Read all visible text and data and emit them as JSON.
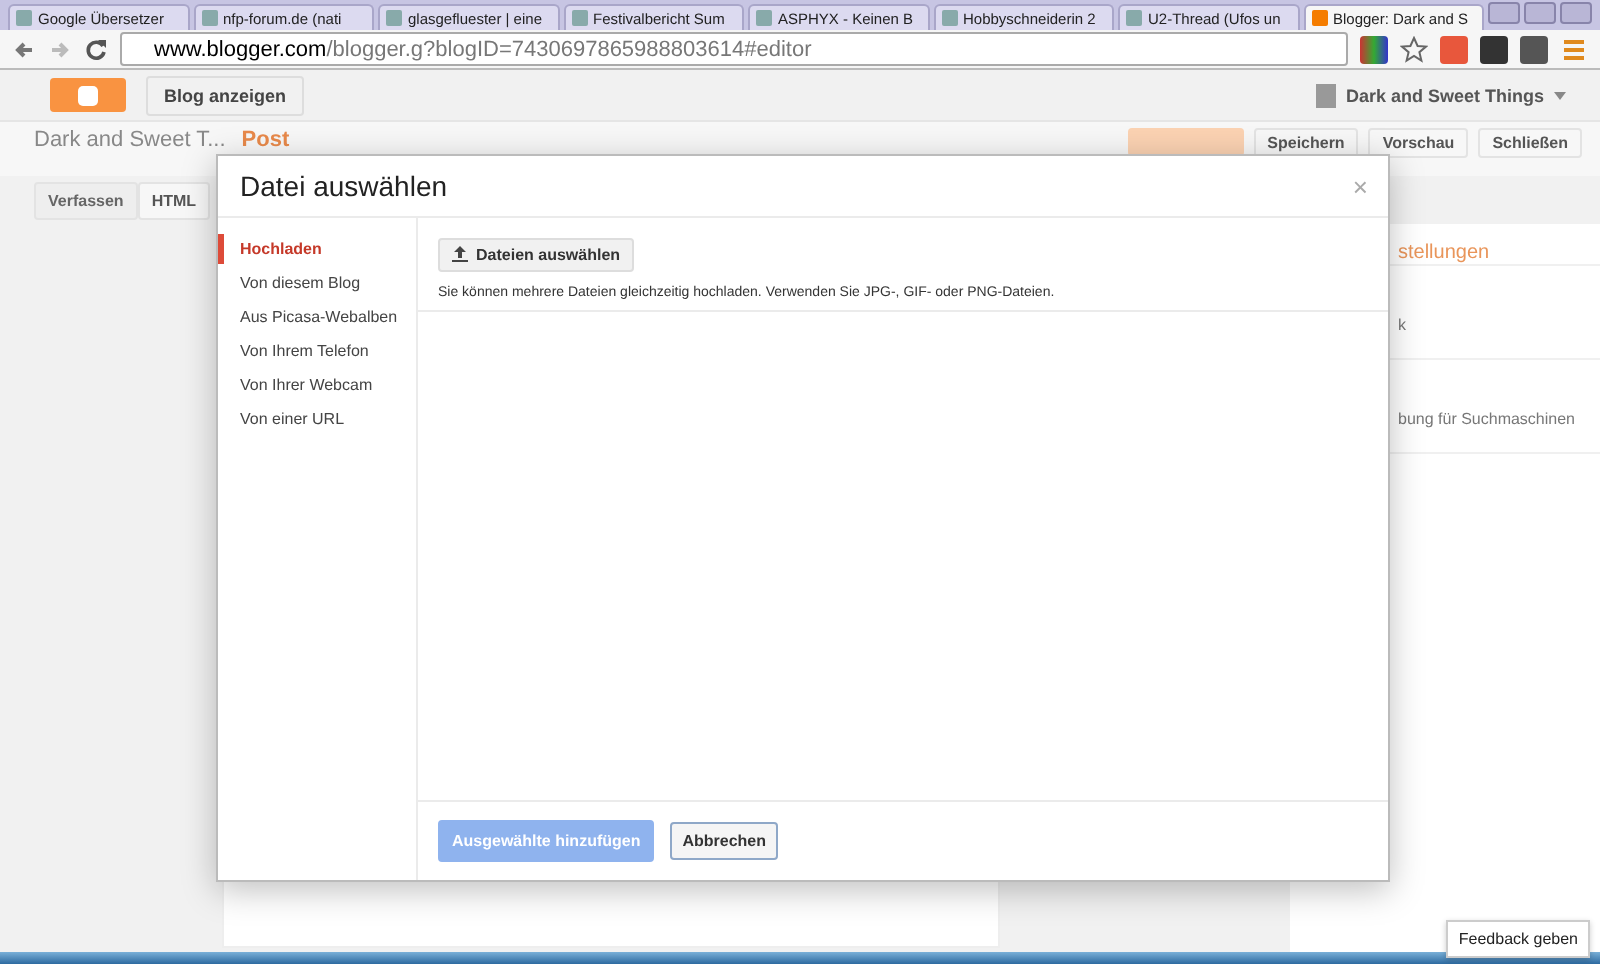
{
  "browser": {
    "tabs": [
      {
        "title": "Google Übersetzer",
        "selected": false
      },
      {
        "title": "nfp-forum.de (nati",
        "selected": false
      },
      {
        "title": "glasgefluester | eine",
        "selected": false
      },
      {
        "title": "Festivalbericht Sum",
        "selected": false
      },
      {
        "title": "ASPHYX - Keinen B",
        "selected": false
      },
      {
        "title": "Hobbyschneiderin 2",
        "selected": false
      },
      {
        "title": "U2-Thread (Ufos un",
        "selected": false
      },
      {
        "title": "Blogger: Dark and S",
        "selected": true
      }
    ],
    "url_host": "www.blogger.com",
    "url_path": "/blogger.g?blogID=7430697865988803614#editor"
  },
  "header": {
    "view_blog": "Blog anzeigen",
    "account": "Dark and Sweet Things"
  },
  "editor": {
    "blog_title": "Dark and Sweet T...",
    "post_label": "Post",
    "buttons": [
      "Speichern",
      "Vorschau",
      "Schließen"
    ],
    "modes": [
      {
        "label": "Verfassen",
        "selected": true
      },
      {
        "label": "HTML",
        "selected": false
      }
    ],
    "settings_heading": "stellungen",
    "settings_items": [
      "k",
      "bung für Suchmaschinen"
    ]
  },
  "dialog": {
    "title": "Datei auswählen",
    "close": "×",
    "nav": [
      {
        "label": "Hochladen",
        "selected": true
      },
      {
        "label": "Von diesem Blog",
        "selected": false
      },
      {
        "label": "Aus Picasa-Webalben",
        "selected": false
      },
      {
        "label": "Von Ihrem Telefon",
        "selected": false
      },
      {
        "label": "Von Ihrer Webcam",
        "selected": false
      },
      {
        "label": "Von einer URL",
        "selected": false
      }
    ],
    "upload_button": "Dateien auswählen",
    "hint": "Sie können mehrere Dateien gleichzeitig hochladen. Verwenden Sie JPG-, GIF- oder PNG-Dateien.",
    "add_button": {
      "label": "Ausgewählte hinzufügen",
      "disabled": true
    },
    "cancel_button": "Abbrechen"
  },
  "feedback_button": "Feedback geben"
}
